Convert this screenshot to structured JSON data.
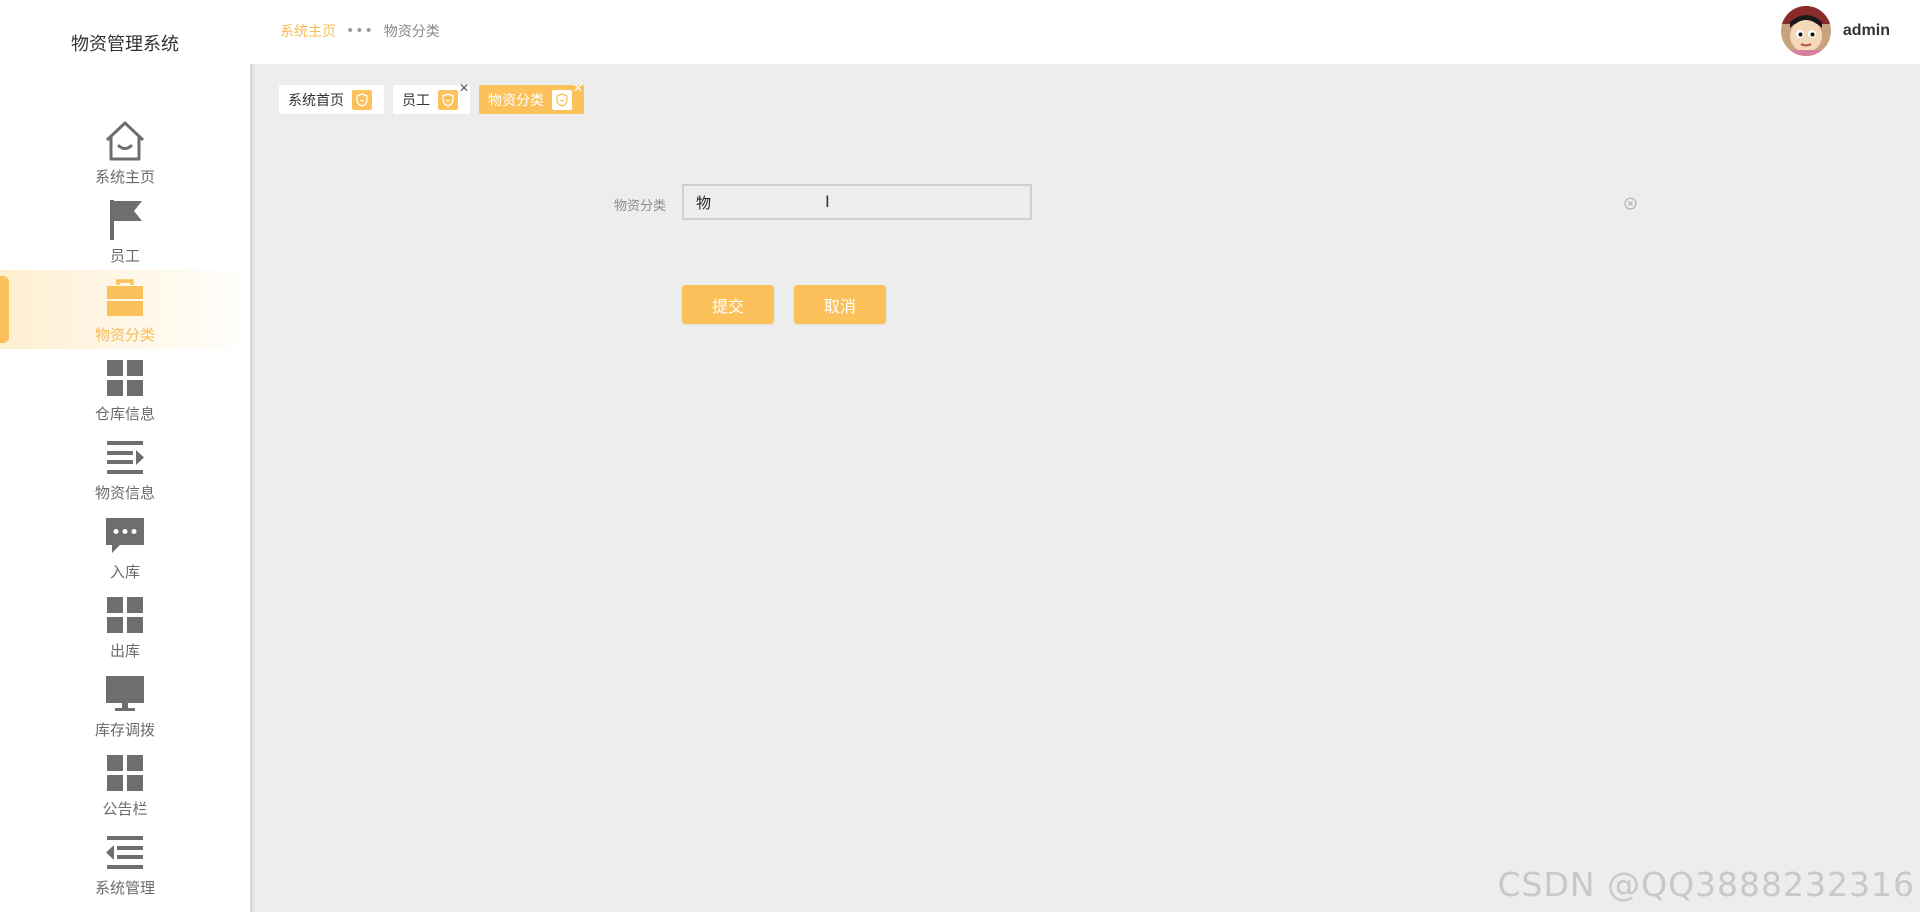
{
  "app": {
    "title": "物资管理系统"
  },
  "sidebar": {
    "items": [
      {
        "label": "系统主页",
        "icon": "home-icon",
        "active": false
      },
      {
        "label": "员工",
        "icon": "flag-icon",
        "active": false
      },
      {
        "label": "物资分类",
        "icon": "briefcase-icon",
        "active": true
      },
      {
        "label": "仓库信息",
        "icon": "grid-icon",
        "active": false
      },
      {
        "label": "物资信息",
        "icon": "list-indent-icon",
        "active": false
      },
      {
        "label": "入库",
        "icon": "chat-icon",
        "active": false
      },
      {
        "label": "出库",
        "icon": "grid-icon",
        "active": false
      },
      {
        "label": "库存调拨",
        "icon": "monitor-icon",
        "active": false
      },
      {
        "label": "公告栏",
        "icon": "grid-icon",
        "active": false
      },
      {
        "label": "系统管理",
        "icon": "list-outdent-icon",
        "active": false
      }
    ]
  },
  "header": {
    "breadcrumb": {
      "home": "系统主页",
      "separator": "•••",
      "current": "物资分类"
    },
    "user": {
      "name": "admin"
    }
  },
  "tags": [
    {
      "label": "系统首页",
      "active": false,
      "closable": false
    },
    {
      "label": "员工",
      "active": false,
      "closable": true
    },
    {
      "label": "物资分类",
      "active": true,
      "closable": true
    }
  ],
  "form": {
    "label": "物资分类",
    "value": "物",
    "submit_label": "提交",
    "cancel_label": "取消"
  },
  "colors": {
    "accent": "#fcc15b",
    "active_text": "#f7bc55",
    "background": "#ededed",
    "icon_gray": "#6e6e6e"
  },
  "watermark": "CSDN @QQ3888232316"
}
